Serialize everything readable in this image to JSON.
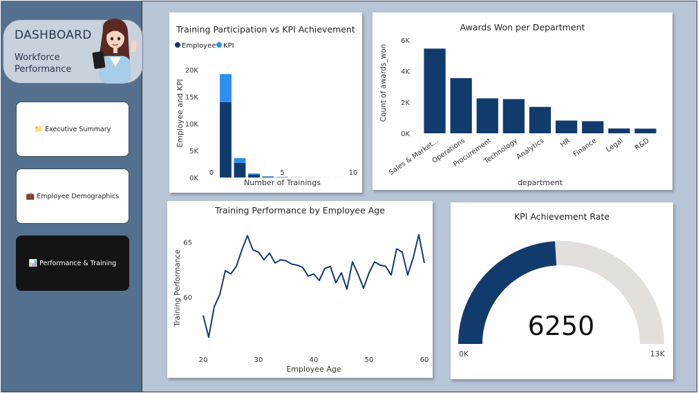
{
  "sidebar": {
    "header": {
      "title": "DASHBOARD",
      "subtitle_line1": "Workforce",
      "subtitle_line2": "Performance"
    },
    "nav": [
      {
        "icon": "📁",
        "label": "Executive Summary",
        "active": false
      },
      {
        "icon": "💼",
        "label": "Employee Demographics",
        "active": false
      },
      {
        "icon": "📊",
        "label": "Performance & Training",
        "active": true
      }
    ]
  },
  "colors": {
    "dark_blue": "#123b6d",
    "light_blue": "#2b8ff2",
    "gauge_bg": "#e3dfda",
    "sidebar": "#54708f",
    "canvas": "#b7c5d6"
  },
  "chart_data": [
    {
      "id": "training",
      "type": "bar",
      "title": "Training Participation vs KPI Achievement",
      "xlabel": "Number of Trainings",
      "ylabel": "Employee and KPI",
      "legend": [
        "Employee",
        "KPI"
      ],
      "x": [
        1,
        2,
        3,
        4,
        5,
        6,
        7,
        8,
        9,
        10
      ],
      "series": [
        {
          "name": "Employee",
          "values": [
            14000,
            2700,
            550,
            150,
            60,
            30,
            15,
            8,
            4,
            2
          ]
        },
        {
          "name": "KPI",
          "values": [
            5200,
            900,
            200,
            60,
            25,
            12,
            6,
            3,
            2,
            1
          ]
        }
      ],
      "stacked": true,
      "xticks": [
        "0",
        "5",
        "10"
      ],
      "yticks": [
        "0K",
        "5K",
        "10K",
        "15K",
        "20K"
      ],
      "ylim": [
        0,
        20000
      ]
    },
    {
      "id": "awards",
      "type": "bar",
      "title": "Awards Won per Department",
      "xlabel": "department",
      "ylabel": "Count of awards_won",
      "categories": [
        "Sales & Market...",
        "Operations",
        "Procurement",
        "Technology",
        "Analytics",
        "HR",
        "Finance",
        "Legal",
        "R&D"
      ],
      "values": [
        5450,
        3550,
        2250,
        2200,
        1700,
        820,
        780,
        310,
        300
      ],
      "yticks": [
        "0K",
        "2K",
        "4K",
        "6K"
      ],
      "ylim": [
        0,
        6000
      ]
    },
    {
      "id": "age",
      "type": "line",
      "title": "Training Performance by Employee Age",
      "xlabel": "Employee Age",
      "ylabel": "Training Performance",
      "x": [
        20,
        21,
        22,
        23,
        24,
        25,
        26,
        27,
        28,
        29,
        30,
        31,
        32,
        33,
        34,
        35,
        36,
        37,
        38,
        39,
        40,
        41,
        42,
        43,
        44,
        45,
        46,
        47,
        48,
        49,
        50,
        51,
        52,
        53,
        54,
        55,
        56,
        57,
        58,
        59,
        60
      ],
      "values": [
        58.3,
        56.3,
        59.1,
        60.2,
        62.4,
        62.1,
        62.8,
        64.3,
        65.6,
        64.3,
        64.1,
        63.4,
        64.0,
        63.1,
        63.4,
        63.3,
        63.0,
        62.9,
        62.7,
        61.9,
        62.1,
        61.5,
        62.6,
        62.8,
        61.3,
        62.2,
        60.7,
        63.2,
        62.1,
        60.8,
        62.2,
        63.2,
        62.9,
        62.8,
        62.0,
        64.4,
        64.1,
        62.0,
        63.6,
        65.7,
        63.1
      ],
      "xticks": [
        "20",
        "30",
        "40",
        "50",
        "60"
      ],
      "yticks": [
        "60",
        "65"
      ],
      "xlim": [
        20,
        60
      ],
      "ylim": [
        55.5,
        66.5
      ]
    },
    {
      "id": "gauge",
      "type": "gauge",
      "title": "KPI Achievement Rate",
      "value": 6250,
      "display_value": "6250",
      "min": 0,
      "max": 13000,
      "min_label": "0K",
      "max_label": "13K"
    }
  ]
}
